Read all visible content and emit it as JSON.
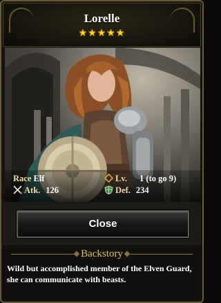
{
  "hero": {
    "name": "Lorelle",
    "stars": "★★★★★",
    "rarity_stars": 5
  },
  "stats": {
    "race_label": "Race",
    "race_value": "Elf",
    "level_label": "Lv.",
    "level_value": "1 (to go 9)",
    "atk_label": "Atk.",
    "atk_value": "126",
    "def_label": "Def.",
    "def_value": "234"
  },
  "actions": {
    "close_label": "Close"
  },
  "backstory": {
    "title": "Backstory",
    "text": "Wild but accomplished member of the Elven Guard, she can communicate with beasts."
  },
  "colors": {
    "star": "#ffd21e",
    "label_gold": "#f0dca0",
    "backstory_title": "#e7c25f",
    "def_icon_green": "#2f8f3a",
    "level_icon_gold": "#d7a640"
  },
  "icons": {
    "atk": "crossed-swords-icon",
    "def": "shield-icon",
    "level": "diamond-icon"
  }
}
